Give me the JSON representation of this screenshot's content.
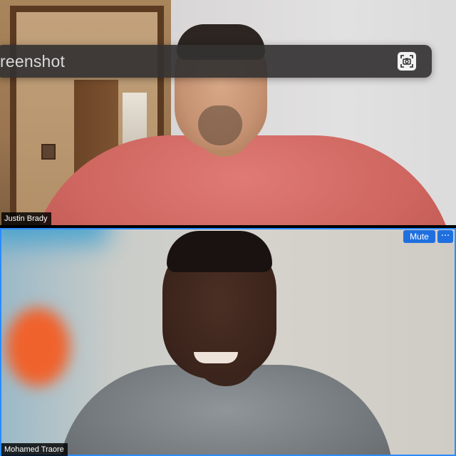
{
  "screenshot_toolbar": {
    "title": "reenshot",
    "capture_icon": "camera-capture-icon"
  },
  "participants": [
    {
      "name": "Justin Brady"
    },
    {
      "name": "Mohamed Traore"
    }
  ],
  "tile_controls": {
    "mute_label": "Mute",
    "more_label": "···"
  },
  "colors": {
    "accent": "#1f6fe0",
    "active_speaker_border": "#2a8bff",
    "toolbar_bg": "#343232"
  }
}
